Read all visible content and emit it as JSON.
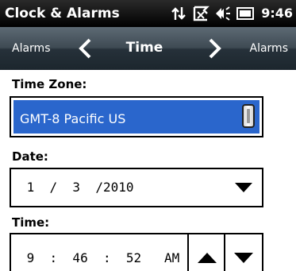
{
  "status_bar": {
    "app_title": "Clock & Alarms",
    "time": "9:46",
    "icons": [
      "data-connection-icon",
      "no-signal-icon",
      "speaker-icon",
      "battery-icon"
    ]
  },
  "nav": {
    "prev_label": "Alarms",
    "title": "Time",
    "next_label": "Alarms"
  },
  "time_zone": {
    "label": "Time Zone:",
    "value": "GMT-8 Pacific US"
  },
  "date": {
    "label": "Date:",
    "value": " 1  /  3  /2010"
  },
  "time": {
    "label": "Time:",
    "value": " 9  :  46  :  52   AM"
  },
  "colors": {
    "selection": "#2a66cc",
    "status_bar": "#000000",
    "nav_bar": "#3e4a53"
  }
}
